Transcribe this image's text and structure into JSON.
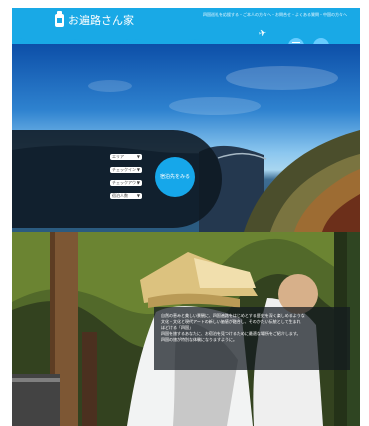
{
  "header": {
    "site_name": "お遍路さん家",
    "tagline": "四国巡礼を応援する・ご本人の方々へ・お問合せ・よくある質問・中国の方々へ",
    "colors": {
      "header": "#19a9e6",
      "button": "#66ccff"
    }
  },
  "hero": {
    "selects": [
      {
        "label": "エリア"
      },
      {
        "label": "チェックイン"
      },
      {
        "label": "チェックアウト"
      },
      {
        "label": "宿泊人数"
      }
    ],
    "search_button": "宿泊先をみる",
    "accent_color": "#16a7ea"
  },
  "text_block": {
    "lines": [
      "自然の恵みと美しい景観に、四国遍路をはじめとする歴史を深く楽しめるような",
      "文化・文化と現代アートの新しい価値が融合し、そのかたい伝統として生まれ",
      "ほどける「四国」",
      "四国を旅するあなたに、お宿泊を見つけるために最適な場所をご紹介します。",
      "四国の旅が特別な体験になりますように。"
    ]
  },
  "icons": {
    "logo": "temple-logo-icon",
    "menu": "hamburger-icon",
    "login": "login-icon",
    "plane": "paper-plane-icon",
    "chevron": "chevron-down-icon"
  }
}
